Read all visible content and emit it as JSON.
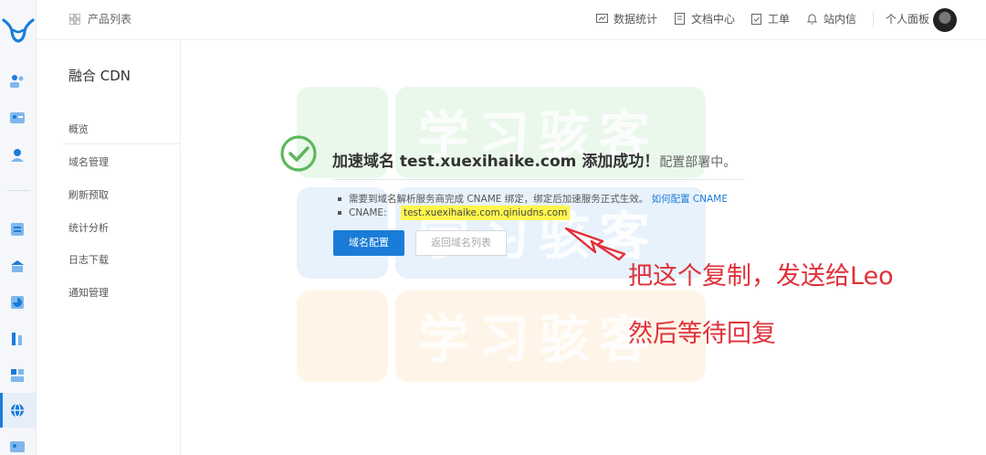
{
  "header": {
    "product_list": "产品列表",
    "nav": [
      {
        "label": "数据统计",
        "icon": "chart-icon"
      },
      {
        "label": "文档中心",
        "icon": "document-icon"
      },
      {
        "label": "工单",
        "icon": "ticket-icon"
      },
      {
        "label": "站内信",
        "icon": "bell-icon"
      }
    ],
    "dashboard": "个人面板"
  },
  "sidebar": {
    "title": "融合 CDN",
    "items": [
      "概览",
      "域名管理",
      "刷新预取",
      "统计分析",
      "日志下载",
      "通知管理"
    ]
  },
  "watermark": {
    "text_1": "学习骇客",
    "text_2": "学习骇客",
    "text_3": "学习骇客"
  },
  "result": {
    "prefix": "加速域名",
    "domain": "test.xuexihaike.com",
    "suffix": "添加成功！",
    "tail": "配置部署中。",
    "bullet_1_text": "需要到域名解析服务商完成 CNAME 绑定，绑定后加速服务正式生效。",
    "bullet_1_link": "如何配置 CNAME",
    "cname_label": "CNAME:",
    "cname_value": "test.xuexihaike.com.qiniudns.com",
    "primary_button": "域名配置",
    "secondary_button": "返回域名列表"
  },
  "annotation": {
    "line_1": "把这个复制，发送给Leo",
    "line_2": "然后等待回复"
  },
  "colors": {
    "accent": "#1a7cd9",
    "success": "#5cb85c",
    "highlight": "#fff64d",
    "annotation": "#e0313a"
  }
}
